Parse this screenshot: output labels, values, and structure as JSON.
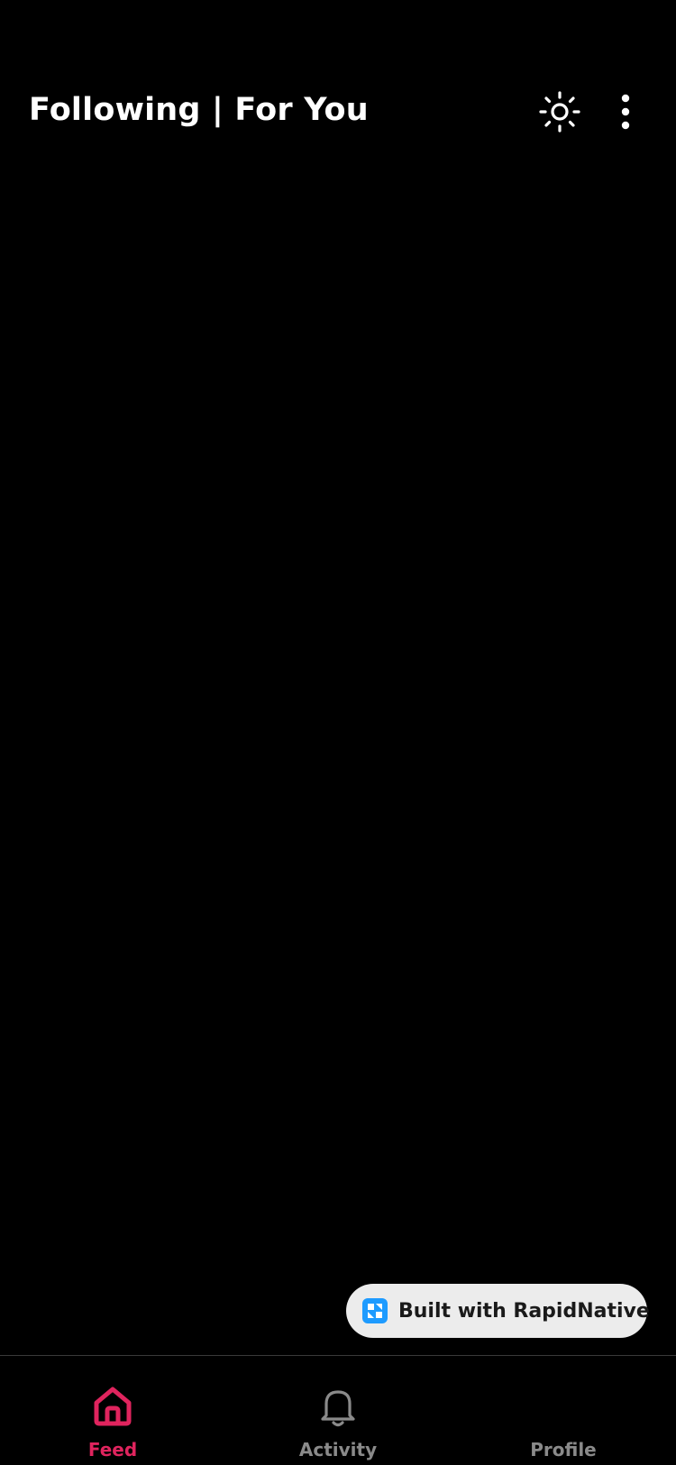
{
  "header": {
    "title": "Following | For You",
    "theme_icon": "sun-icon",
    "more_icon": "more-vertical-icon"
  },
  "feed": {
    "items": []
  },
  "badge": {
    "label": "Built with RapidNative",
    "logo_icon": "rapidnative-logo-icon"
  },
  "tabbar": {
    "tabs": [
      {
        "label": "Feed",
        "icon": "home-icon",
        "active": true
      },
      {
        "label": "Activity",
        "icon": "bell-icon",
        "active": false
      },
      {
        "label": "Profile",
        "icon": "",
        "active": false
      }
    ]
  },
  "colors": {
    "background": "#000000",
    "text_primary": "#ffffff",
    "accent": "#e0245e",
    "inactive_icon": "#8a8a8a",
    "badge_background": "#ececec",
    "badge_logo": "#1e9bff",
    "divider": "#3a3a3a"
  }
}
